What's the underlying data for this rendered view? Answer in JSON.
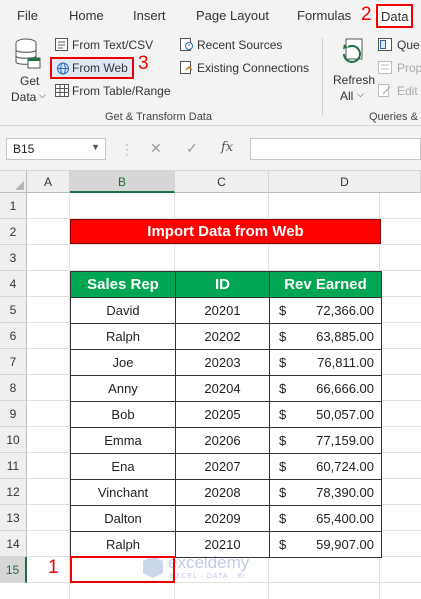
{
  "ribbon_tabs": {
    "file": "File",
    "home": "Home",
    "insert": "Insert",
    "page_layout": "Page Layout",
    "formulas": "Formulas",
    "data": "Data"
  },
  "ribbon": {
    "get_data_line1": "Get",
    "get_data_line2": "Data",
    "from_text_csv": "From Text/CSV",
    "from_web": "From Web",
    "from_table_range": "From Table/Range",
    "recent_sources": "Recent Sources",
    "existing_connections": "Existing Connections",
    "get_transform_label": "Get & Transform Data",
    "refresh_line1": "Refresh",
    "refresh_line2": "All",
    "queries_label": "Queries &",
    "queries_btn": "Que",
    "properties_btn": "Prop",
    "edit_links_btn": "Edit"
  },
  "steps": {
    "one": "1",
    "two": "2",
    "three": "3"
  },
  "formula_bar": {
    "name_box": "B15",
    "fx": "fx"
  },
  "grid": {
    "columns": [
      "A",
      "B",
      "C",
      "D"
    ],
    "rows": [
      "1",
      "2",
      "3",
      "4",
      "5",
      "6",
      "7",
      "8",
      "9",
      "10",
      "11",
      "12",
      "13",
      "14",
      "15"
    ]
  },
  "sheet": {
    "title": "Import Data from Web",
    "headers": [
      "Sales Rep",
      "ID",
      "Rev Earned"
    ],
    "currency_symbol": "$",
    "rows": [
      {
        "rep": "David",
        "id": "20201",
        "rev": "72,366.00"
      },
      {
        "rep": "Ralph",
        "id": "20202",
        "rev": "63,885.00"
      },
      {
        "rep": "Joe",
        "id": "20203",
        "rev": "76,811.00"
      },
      {
        "rep": "Anny",
        "id": "20204",
        "rev": "66,666.00"
      },
      {
        "rep": "Bob",
        "id": "20205",
        "rev": "50,057.00"
      },
      {
        "rep": "Emma",
        "id": "20206",
        "rev": "77,159.00"
      },
      {
        "rep": "Ena",
        "id": "20207",
        "rev": "60,724.00"
      },
      {
        "rep": "Vinchant",
        "id": "20208",
        "rev": "78,390.00"
      },
      {
        "rep": "Dalton",
        "id": "20209",
        "rev": "65,400.00"
      },
      {
        "rep": "Ralph",
        "id": "20210",
        "rev": "59,907.00"
      }
    ]
  },
  "watermark": {
    "name": "exceldemy",
    "tagline": "EXCEL · DATA · BI"
  },
  "colors": {
    "accent_red": "#ff0000",
    "header_green": "#00a651",
    "excel_green": "#1e7145"
  }
}
